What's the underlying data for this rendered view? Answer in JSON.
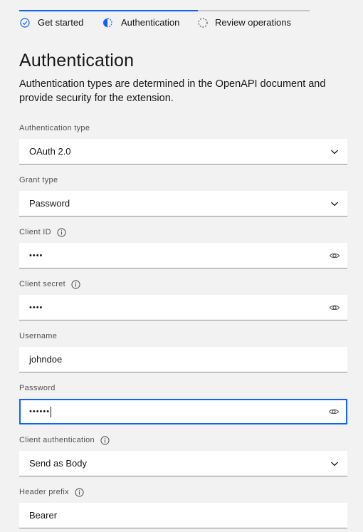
{
  "progress": {
    "steps": [
      {
        "label": "Get started",
        "state": "complete",
        "icon": "checkmark-outline-icon"
      },
      {
        "label": "Authentication",
        "state": "current",
        "icon": "incomplete-half-icon"
      },
      {
        "label": "Review operations",
        "state": "incomplete",
        "icon": "circle-dash-icon"
      }
    ]
  },
  "heading": "Authentication",
  "description": "Authentication types are determined in the OpenAPI document and provide security for the extension.",
  "fields": {
    "auth_type": {
      "label": "Authentication type",
      "value": "OAuth 2.0",
      "icon": "chevron-down-icon"
    },
    "grant_type": {
      "label": "Grant type",
      "value": "Password",
      "icon": "chevron-down-icon"
    },
    "client_id": {
      "label": "Client ID",
      "value": "••••",
      "icon": "view-icon",
      "info_icon": "information-icon"
    },
    "client_secret": {
      "label": "Client secret",
      "value": "••••",
      "icon": "view-icon",
      "info_icon": "information-icon"
    },
    "username": {
      "label": "Username",
      "value": "johndoe"
    },
    "password": {
      "label": "Password",
      "value": "••••••",
      "icon": "view-icon"
    },
    "client_auth": {
      "label": "Client authentication",
      "value": "Send as Body",
      "icon": "chevron-down-icon",
      "info_icon": "information-icon"
    },
    "header_prefix": {
      "label": "Header prefix",
      "value": "Bearer",
      "info_icon": "information-icon"
    }
  },
  "colors": {
    "accent": "#0f62fe",
    "background": "#f2f2f2",
    "field_bg": "#ffffff",
    "text": "#161616",
    "label": "#525252",
    "border": "#8d8d8d"
  }
}
